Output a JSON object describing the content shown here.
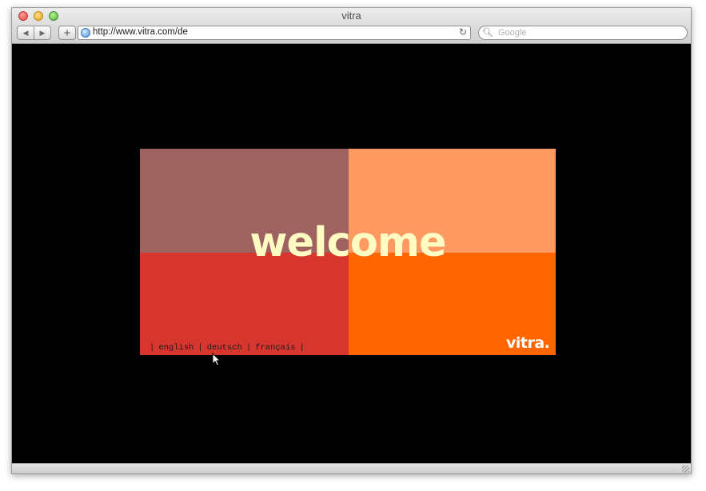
{
  "browser": {
    "title": "vitra",
    "url": "http://www.vitra.com/de",
    "search_placeholder": "Google",
    "icons": {
      "back": "back-arrow-icon",
      "forward": "forward-arrow-icon",
      "add": "plus-icon",
      "site": "globe-icon",
      "reload": "reload-icon",
      "search": "magnifier-icon"
    }
  },
  "splash": {
    "headline": "welcome",
    "logo": "vitra.",
    "languages": [
      {
        "label": "english"
      },
      {
        "label": "deutsch"
      },
      {
        "label": "français"
      }
    ],
    "separator": "|",
    "colors": {
      "top_left": "#9e6361",
      "top_right": "#fe9962",
      "bottom_left": "#d7362e",
      "bottom_right": "#ff6500",
      "headline": "#fffbc2",
      "language_text": "#1a1a1a"
    }
  },
  "colors": {
    "page_background": "#000000"
  }
}
